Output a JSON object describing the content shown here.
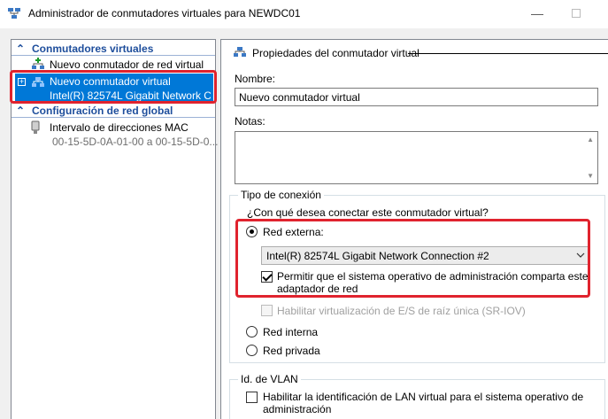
{
  "window": {
    "title": "Administrador de conmutadores virtuales para NEWDC01",
    "minimize_glyph": "—",
    "app_icon": "virtual-switch-manager-icon"
  },
  "tree": {
    "switches_header": "Conmutadores virtuales",
    "new_switch_item": "Nuevo conmutador de red virtual",
    "selected_switch": {
      "name": "Nuevo conmutador virtual",
      "adapter": "Intel(R) 82574L Gigabit Network C...",
      "expander": "+"
    },
    "global_header": "Configuración de red global",
    "mac_item": {
      "label": "Intervalo de direcciones MAC",
      "value": "00-15-5D-0A-01-00 a 00-15-5D-0..."
    },
    "chevron_up": "⌃"
  },
  "properties": {
    "header": "Propiedades del conmutador virtual",
    "name_label": "Nombre:",
    "name_value": "Nuevo conmutador virtual",
    "notes_label": "Notas:",
    "connection_group": "Tipo de conexión",
    "connection_question": "¿Con qué desea conectar este conmutador virtual?",
    "external_label": "Red externa:",
    "external_adapter": "Intel(R) 82574L Gigabit Network Connection #2",
    "allow_mgmt_line1": "Permitir que el sistema operativo de administración comparta este",
    "allow_mgmt_line2": "adaptador de red",
    "sriov_label": "Habilitar virtualización de E/S de raíz única (SR-IOV)",
    "internal_label": "Red interna",
    "private_label": "Red privada",
    "vlan_group": "Id. de VLAN",
    "vlan_line1": "Habilitar la identificación de LAN virtual para el sistema operativo de",
    "vlan_line2": "administración"
  },
  "state": {
    "connection_type": "external",
    "allow_mgmt_checked": true,
    "sriov_checked": false,
    "sriov_enabled": false,
    "vlan_checked": false
  },
  "colors": {
    "selection": "#0078d7",
    "header_blue": "#1e4e9c",
    "highlight_red": "#e0232e"
  }
}
